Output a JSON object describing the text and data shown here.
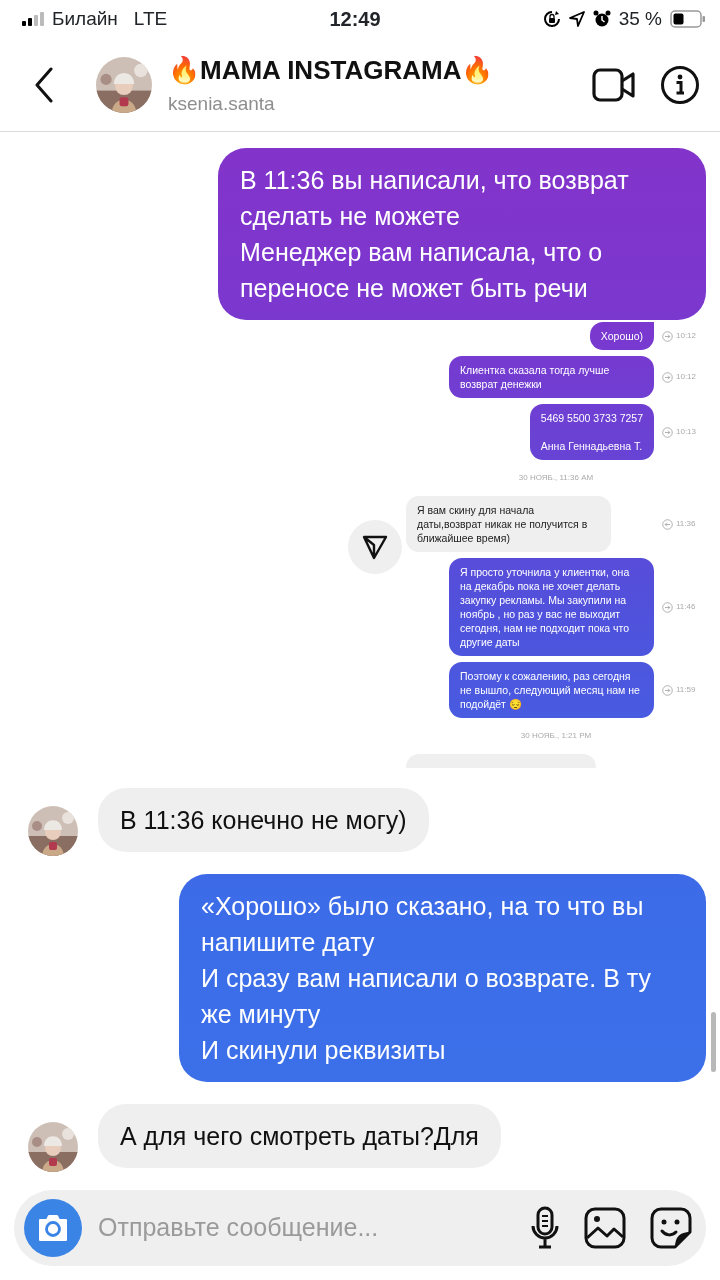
{
  "status_bar": {
    "carrier": "Билайн",
    "network": "LTE",
    "time": "12:49",
    "battery": "35 %"
  },
  "header": {
    "title": "🔥MAMA INSTAGRAMA🔥",
    "username": "ksenia.santa"
  },
  "messages": [
    {
      "kind": "text",
      "outgoing": true,
      "paragraphs": [
        "В 11:36 вы написали, что возврат сделать не можете",
        "Менеджер вам написала, что о переносе не может быть речи"
      ]
    },
    {
      "kind": "screenshot",
      "items": [
        {
          "kind": "bubble",
          "outgoing": true,
          "lines": [
            "Хорошо)"
          ],
          "time": "10:12"
        },
        {
          "kind": "bubble",
          "outgoing": true,
          "lines": [
            "Клиентка сказала тогда лучше возврат денежки"
          ],
          "time": "10:12"
        },
        {
          "kind": "bubble",
          "outgoing": true,
          "lines": [
            "5469 5500 3733 7257",
            "Анна Геннадьевна Т."
          ],
          "time": "10:13"
        },
        {
          "kind": "date",
          "text": "30 НОЯБ., 11:36 AM"
        },
        {
          "kind": "bubble",
          "outgoing": false,
          "lines": [
            "Я вам скину для начала даты,возврат никак не получится в ближайшее время)"
          ],
          "time": "11:36"
        },
        {
          "kind": "bubble",
          "outgoing": true,
          "lines": [
            "Я просто уточнила у клиентки, она на декабрь пока не хочет делать закупку рекламы. Мы закупили на ноябрь , но раз у вас не выходит сегодня, нам не подходит пока что другие даты"
          ],
          "time": "11:46"
        },
        {
          "kind": "bubble",
          "outgoing": true,
          "lines": [
            "Поэтому к сожалению, раз сегодня не вышло, следующий месяц нам не подойдёт 😔"
          ],
          "time": "11:59"
        },
        {
          "kind": "date",
          "text": "30 НОЯБ., 1:21 PM"
        },
        {
          "kind": "cut"
        }
      ]
    },
    {
      "kind": "text",
      "outgoing": false,
      "paragraphs": [
        "В 11:36 конечно не могу)"
      ]
    },
    {
      "kind": "text",
      "outgoing": true,
      "paragraphs": [
        "«Хорошо» было сказано, на то что вы напишите дату",
        "И сразу вам написали о возврате. В ту же минуту",
        "И скинули реквизиты"
      ]
    },
    {
      "kind": "text",
      "outgoing": false,
      "paragraphs": [
        "А для чего смотреть даты?Для"
      ]
    }
  ],
  "composer": {
    "placeholder": "Отправьте сообщение..."
  }
}
